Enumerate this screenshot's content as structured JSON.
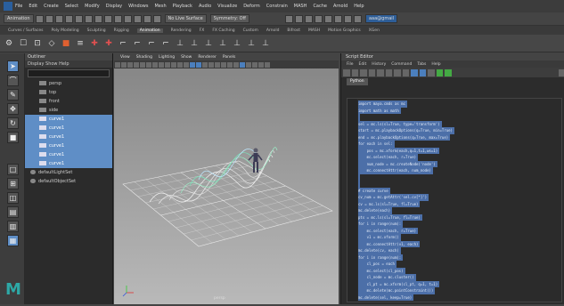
{
  "menubar": {
    "items": [
      "File",
      "Edit",
      "Create",
      "Select",
      "Modify",
      "Display",
      "Windows",
      "Mesh",
      "Playback",
      "Audio",
      "Visualize",
      "Deform",
      "Constrain",
      "MASH",
      "Cache",
      "Arnold",
      "Help"
    ]
  },
  "status": {
    "mode": "Animation",
    "no_live": "No Live Surface",
    "symmetry": "Symmetry: Off",
    "account": "aaa@gmail"
  },
  "shelf": {
    "tabs": [
      "Curves / Surfaces",
      "Poly Modeling",
      "Sculpting",
      "Rigging",
      "Animation",
      "Rendering",
      "FX",
      "FX Caching",
      "Custom",
      "Arnold",
      "Bifrost",
      "MASH",
      "Motion Graphics",
      "XGen"
    ],
    "active": "Animation"
  },
  "outliner": {
    "title": "Outliner",
    "menu": "Display  Show  Help",
    "search_placeholder": "Search...",
    "items": [
      {
        "label": "persp",
        "sel": false
      },
      {
        "label": "top",
        "sel": false
      },
      {
        "label": "front",
        "sel": false
      },
      {
        "label": "side",
        "sel": false
      },
      {
        "label": "curve1",
        "sel": true
      },
      {
        "label": "curve1",
        "sel": true
      },
      {
        "label": "curve1",
        "sel": true
      },
      {
        "label": "curve1",
        "sel": true
      },
      {
        "label": "curve1",
        "sel": true
      },
      {
        "label": "curve1",
        "sel": true
      },
      {
        "label": "defaultLightSet",
        "sel": false
      },
      {
        "label": "defaultObjectSet",
        "sel": false
      }
    ]
  },
  "viewport": {
    "menu": [
      "View",
      "Shading",
      "Lighting",
      "Show",
      "Renderer",
      "Panels"
    ],
    "camera": "persp"
  },
  "script": {
    "title": "Script Editor",
    "menu": [
      "File",
      "Edit",
      "History",
      "Command",
      "Tabs",
      "Help"
    ],
    "tab": "Python",
    "lines": [
      "import maya.cmds as mc",
      "import math as math",
      "",
      "sel = mc.ls(sl=True, type='transform')",
      "start = mc.playbackOptions(q=True, min=True)",
      "end = mc.playbackOptions(q=True, max=True)",
      "for each in sel:",
      "    pos = mc.xform(each,q=1,t=1,ws=1)",
      "    mc.select(each, r=True)",
      "    num_node = mc.createNode('node')",
      "    mc.connectAttr(each, num_node)",
      "",
      "",
      "# create curve",
      "cv_num = mc.getAttr('sel.cv[*]')",
      "cv = mc.ls(sl=True, fl=True)",
      "mc.delete(each)",
      "pts = mc.ls(sl=True, fl=True)",
      "for i in range(num):",
      "    mc.select(each, r=True)",
      "    v1 = mc.xform()",
      "    mc.connectAttr(v1, each)",
      "mc.delete(cv, each)",
      "for i in range(num):",
      "    cl_pos = each",
      "    mc.select(cl_pos)",
      "    cl_node = mc.cluster()",
      "    cl_pt = mc.xform(cl_pt, q=1, t=1)",
      "    mc.delete(mc.pointConstraint())",
      "mc.delete(sel, keep=True)",
      "mc.delete(cv)",
      "mc.select(curve, r=True, add=True)"
    ]
  }
}
